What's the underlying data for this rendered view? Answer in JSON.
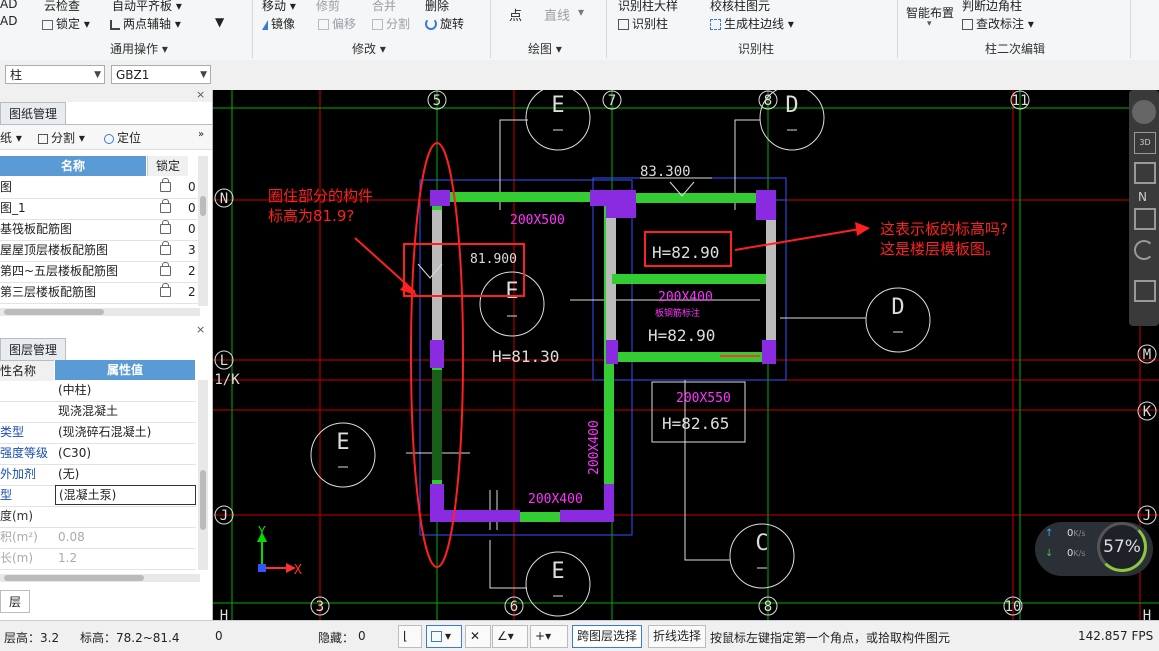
{
  "ribbon": {
    "row1": {
      "ad": "AD",
      "cloud_check": "云检查",
      "flatten": "自动平齐板",
      "move": "移动",
      "trim": "修剪",
      "merge": "合并",
      "delete": "删除",
      "point": "点",
      "identify_column_table": "识别柱大样",
      "check_column_detail": "校核柱图元",
      "smart_layout": "智能布置",
      "judge_edge": "判断边角柱"
    },
    "lock": "锁定",
    "two_point_axis": "两点辅轴",
    "mirror": "镜像",
    "offset": "偏移",
    "split": "分割",
    "rotate": "旋转",
    "line": "直线",
    "identify_column": "识别柱",
    "gen_column_edge": "生成柱边线",
    "check_label": "查改标注",
    "groups": {
      "general": "通用操作",
      "modify": "修改",
      "draw": "绘图",
      "identify": "识别柱",
      "secondary": "柱二次编辑"
    }
  },
  "toolbar": {
    "type_combo": "柱",
    "name_combo": "GBZ1"
  },
  "drawing_panel": {
    "tab": "图纸管理",
    "actions": {
      "paper": "纸",
      "split": "分割",
      "locate": "定位"
    },
    "columns": {
      "name": "名称",
      "lock": "锁定"
    },
    "rows": [
      {
        "name": "图",
        "num": "0"
      },
      {
        "name": "图_1",
        "num": "0"
      },
      {
        "name": "基筏板配筋图",
        "num": "0"
      },
      {
        "name": "屋屋顶层楼板配筋图",
        "num": "3"
      },
      {
        "name": "第四~五层楼板配筋图",
        "num": "2"
      },
      {
        "name": "第三层楼板配筋图",
        "num": "2"
      }
    ]
  },
  "layer_panel": {
    "tab": "图层管理",
    "columns": {
      "name": "性名称",
      "value": "属性值"
    },
    "rows": [
      {
        "key": "",
        "value": "(中柱)",
        "dim": false
      },
      {
        "key": "",
        "value": "现浇混凝土",
        "dim": false
      },
      {
        "key": "类型",
        "value": "(现浇碎石混凝土)",
        "dim": false
      },
      {
        "key": "强度等级",
        "value": "(C30)",
        "dim": false
      },
      {
        "key": "外加剂",
        "value": "(无)",
        "dim": false
      },
      {
        "key": "型",
        "value": "(混凝土泵)",
        "dim": false
      },
      {
        "key": "度(m)",
        "value": "",
        "dim": false
      },
      {
        "key": "积(m²)",
        "value": "0.08",
        "dim": true
      },
      {
        "key": "长(m)",
        "value": "1.2",
        "dim": true
      }
    ],
    "bottom_tab": "层"
  },
  "canvas": {
    "axis_labels": {
      "top": [
        "5",
        "7",
        "8",
        "11"
      ],
      "bottom": [
        "3",
        "6",
        "8",
        "10"
      ],
      "left": [
        "N",
        "L",
        "1/K",
        "J",
        "H"
      ],
      "right": [
        "N",
        "M",
        "K",
        "J",
        "H"
      ],
      "circles": [
        "E",
        "D",
        "E",
        "D",
        "E",
        "C",
        "E"
      ]
    },
    "dims": [
      "200X500",
      "200X400",
      "200X550",
      "200X400",
      "200X400"
    ],
    "elev_labels": [
      "83.300",
      "81.900",
      "H=81.30",
      "H=82.90",
      "H=82.90",
      "H=82.65"
    ],
    "small_label": "板钢筋标注",
    "annotation_left": [
      "圈住部分的构件",
      "标高为81.9?"
    ],
    "annotation_right": [
      "这表示板的标高吗?",
      "这是楼层模板图。"
    ],
    "axis_x": "X",
    "axis_y": "Y",
    "net": {
      "up": "0",
      "down": "0",
      "unit": "K/s",
      "percent": "57%"
    }
  },
  "status": {
    "floor_height": "层高：3.2",
    "elevation": "标高：78.2~81.4",
    "zero": "0",
    "hidden": "隐藏：",
    "hidden_count": "0",
    "cross_layer": "跨图层选择",
    "polyline": "折线选择",
    "hint": "按鼠标左键指定第一个角点，或拾取构件图元",
    "fps": "142.857 FPS"
  },
  "colors": {
    "canvas_bg": "#000000",
    "wall_green": "#33cc33",
    "column_purple": "#8a2be2",
    "axis_red": "#cc0000",
    "annotation_red": "#ff2020",
    "dim_magenta": "#ff33ff"
  }
}
